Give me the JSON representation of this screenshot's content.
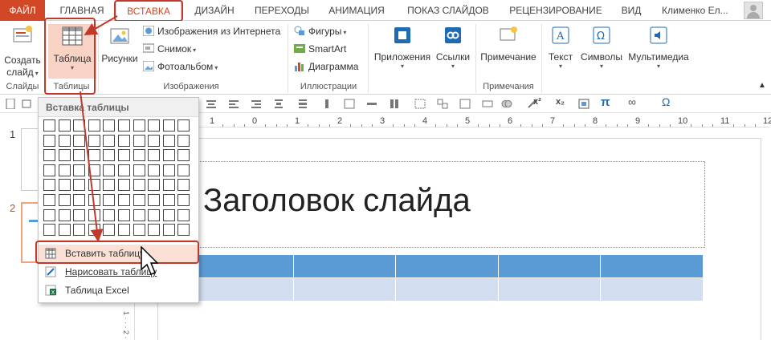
{
  "tabs": {
    "file": "ФАЙЛ",
    "home": "ГЛАВНАЯ",
    "insert": "ВСТАВКА",
    "design": "ДИЗАЙН",
    "transitions": "ПЕРЕХОДЫ",
    "animations": "АНИМАЦИЯ",
    "slideshow": "ПОКАЗ СЛАЙДОВ",
    "review": "РЕЦЕНЗИРОВАНИЕ",
    "view": "ВИД"
  },
  "user": {
    "name": "Клименко Ел..."
  },
  "ribbon": {
    "new_slide": [
      "Создать",
      "слайд"
    ],
    "table": "Таблица",
    "pictures": "Рисунки",
    "online_pictures": "Изображения из Интернета",
    "screenshot": "Снимок",
    "photo_album": "Фотоальбом",
    "shapes": "Фигуры",
    "smartart": "SmartArt",
    "chart": "Диаграмма",
    "apps": "Приложения",
    "links": "Ссылки",
    "comment": "Примечание",
    "text": "Текст",
    "symbols": "Символы",
    "multimedia": "Мультимедиа",
    "groups": {
      "slides": "Слайды",
      "tables": "Таблицы",
      "images": "Изображения",
      "illustrations": "Иллюстрации",
      "comments": "Примечания"
    }
  },
  "thumbnails": {
    "slide1": "1",
    "slide2": "2"
  },
  "ruler": {
    "h_numbers": [
      "1",
      "0",
      "1",
      "2",
      "3",
      "4",
      "5",
      "6",
      "7",
      "8",
      "9",
      "10",
      "11",
      "12"
    ],
    "v_text": "1 · · · 2 ·"
  },
  "slide": {
    "title": "Заголовок слайда",
    "table_cols": 5
  },
  "dropdown": {
    "title": "Вставка таблицы",
    "grid_cols": 10,
    "grid_rows": 8,
    "insert_table": "Вставить таблицу...",
    "draw_table": "Нарисовать таблицу",
    "excel_table": "Таблица Excel"
  },
  "colors": {
    "accent": "#d24726",
    "highlight": "#c0392b",
    "table_header": "#5b9bd5",
    "table_body": "#d2deef"
  }
}
